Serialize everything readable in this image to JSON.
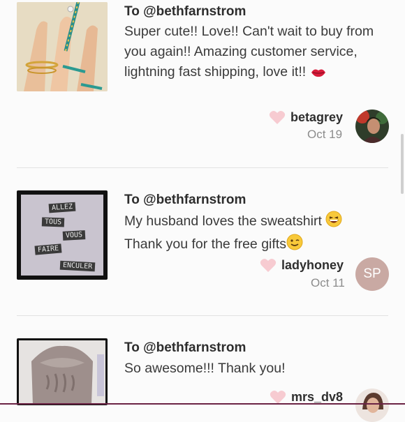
{
  "reviews": [
    {
      "recipient": "To @bethfarnstrom",
      "text": "Super cute!! Love!! Can't wait to buy from you again!! Amazing customer service, lightning fast shipping, love it!!",
      "username": "betagrey",
      "date": "Oct 19",
      "thumbnail_icon": "rings-on-hand-photo",
      "avatar_icon": "user-photo"
    },
    {
      "recipient": "To @bethfarnstrom",
      "text_line1": "My husband loves the sweatshirt",
      "text_line2": "Thank you for the free gifts",
      "username": "ladyhoney",
      "date": "Oct 11",
      "avatar_initials": "SP",
      "thumbnail_words": [
        "ALLEZ",
        "TOUS",
        "VOUS",
        "FAIRE",
        "ENCULER"
      ]
    },
    {
      "recipient": "To @bethfarnstrom",
      "text": "So awesome!!! Thank you!",
      "username": "mrs_dv8",
      "thumbnail_icon": "knit-sweater-photo",
      "avatar_icon": "user-photo"
    }
  ],
  "colors": {
    "heart": "#f7cbd1",
    "avatar_initials_bg": "#c9a9a3",
    "divider": "#e2e2e2"
  }
}
